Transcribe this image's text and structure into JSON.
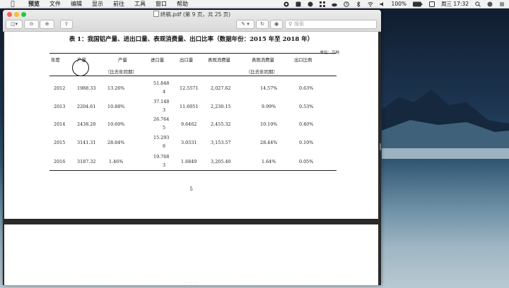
{
  "menubar": {
    "app_name": "预览",
    "items": [
      "文件",
      "编辑",
      "显示",
      "前往",
      "工具",
      "窗口",
      "帮助"
    ],
    "battery": "100%",
    "clock": "周三 17:32"
  },
  "window": {
    "title_file": "终稿.pdf",
    "title_page": "(第 9 页，共 25 页)",
    "search_placeholder": "搜索"
  },
  "document": {
    "title": "表 1：我国铝产量、进出口量、表观消费量、出口比率（数据年份：2015 年至 2018 年）",
    "unit": "单位：万吨",
    "headers": {
      "year": "年度",
      "output": "产量",
      "output_yoy": "产量",
      "output_yoy_sub": "（比去年同期）",
      "import": "进口量",
      "export": "出口量",
      "consumption": "表观消费量",
      "consumption_yoy": "表观消费量",
      "consumption_yoy_sub": "（比去年同期）",
      "export_ratio": "出口比例"
    },
    "rows": [
      {
        "year": "2012",
        "output": "1988.33",
        "output_yoy": "13.26%",
        "import_a": "51.848",
        "import_b": "4",
        "export": "12.5571",
        "consumption": "2,027.62",
        "consumption_yoy": "14.57%",
        "ratio": "0.63%"
      },
      {
        "year": "2013",
        "output": "2204.61",
        "output_yoy": "10.88%",
        "import_a": "37.148",
        "import_b": "3",
        "export": "11.6051",
        "consumption": "2,230.15",
        "consumption_yoy": "9.99%",
        "ratio": "0.53%"
      },
      {
        "year": "2014",
        "output": "2438.20",
        "output_yoy": "10.60%",
        "import_a": "26.764",
        "import_b": "5",
        "export": "9.6462",
        "consumption": "2,455.32",
        "consumption_yoy": "10.10%",
        "ratio": "0.40%"
      },
      {
        "year": "2015",
        "output": "3141.31",
        "output_yoy": "28.84%",
        "import_a": "15.293",
        "import_b": "6",
        "export": "3.0331",
        "consumption": "3,153.57",
        "consumption_yoy": "28.44%",
        "ratio": "0.10%"
      },
      {
        "year": "2016",
        "output": "3187.32",
        "output_yoy": "1.46%",
        "import_a": "19.768",
        "import_b": "3",
        "export": "1.6849",
        "consumption": "3,205.40",
        "consumption_yoy": "1.64%",
        "ratio": "0.05%"
      }
    ],
    "page_number": "5"
  }
}
